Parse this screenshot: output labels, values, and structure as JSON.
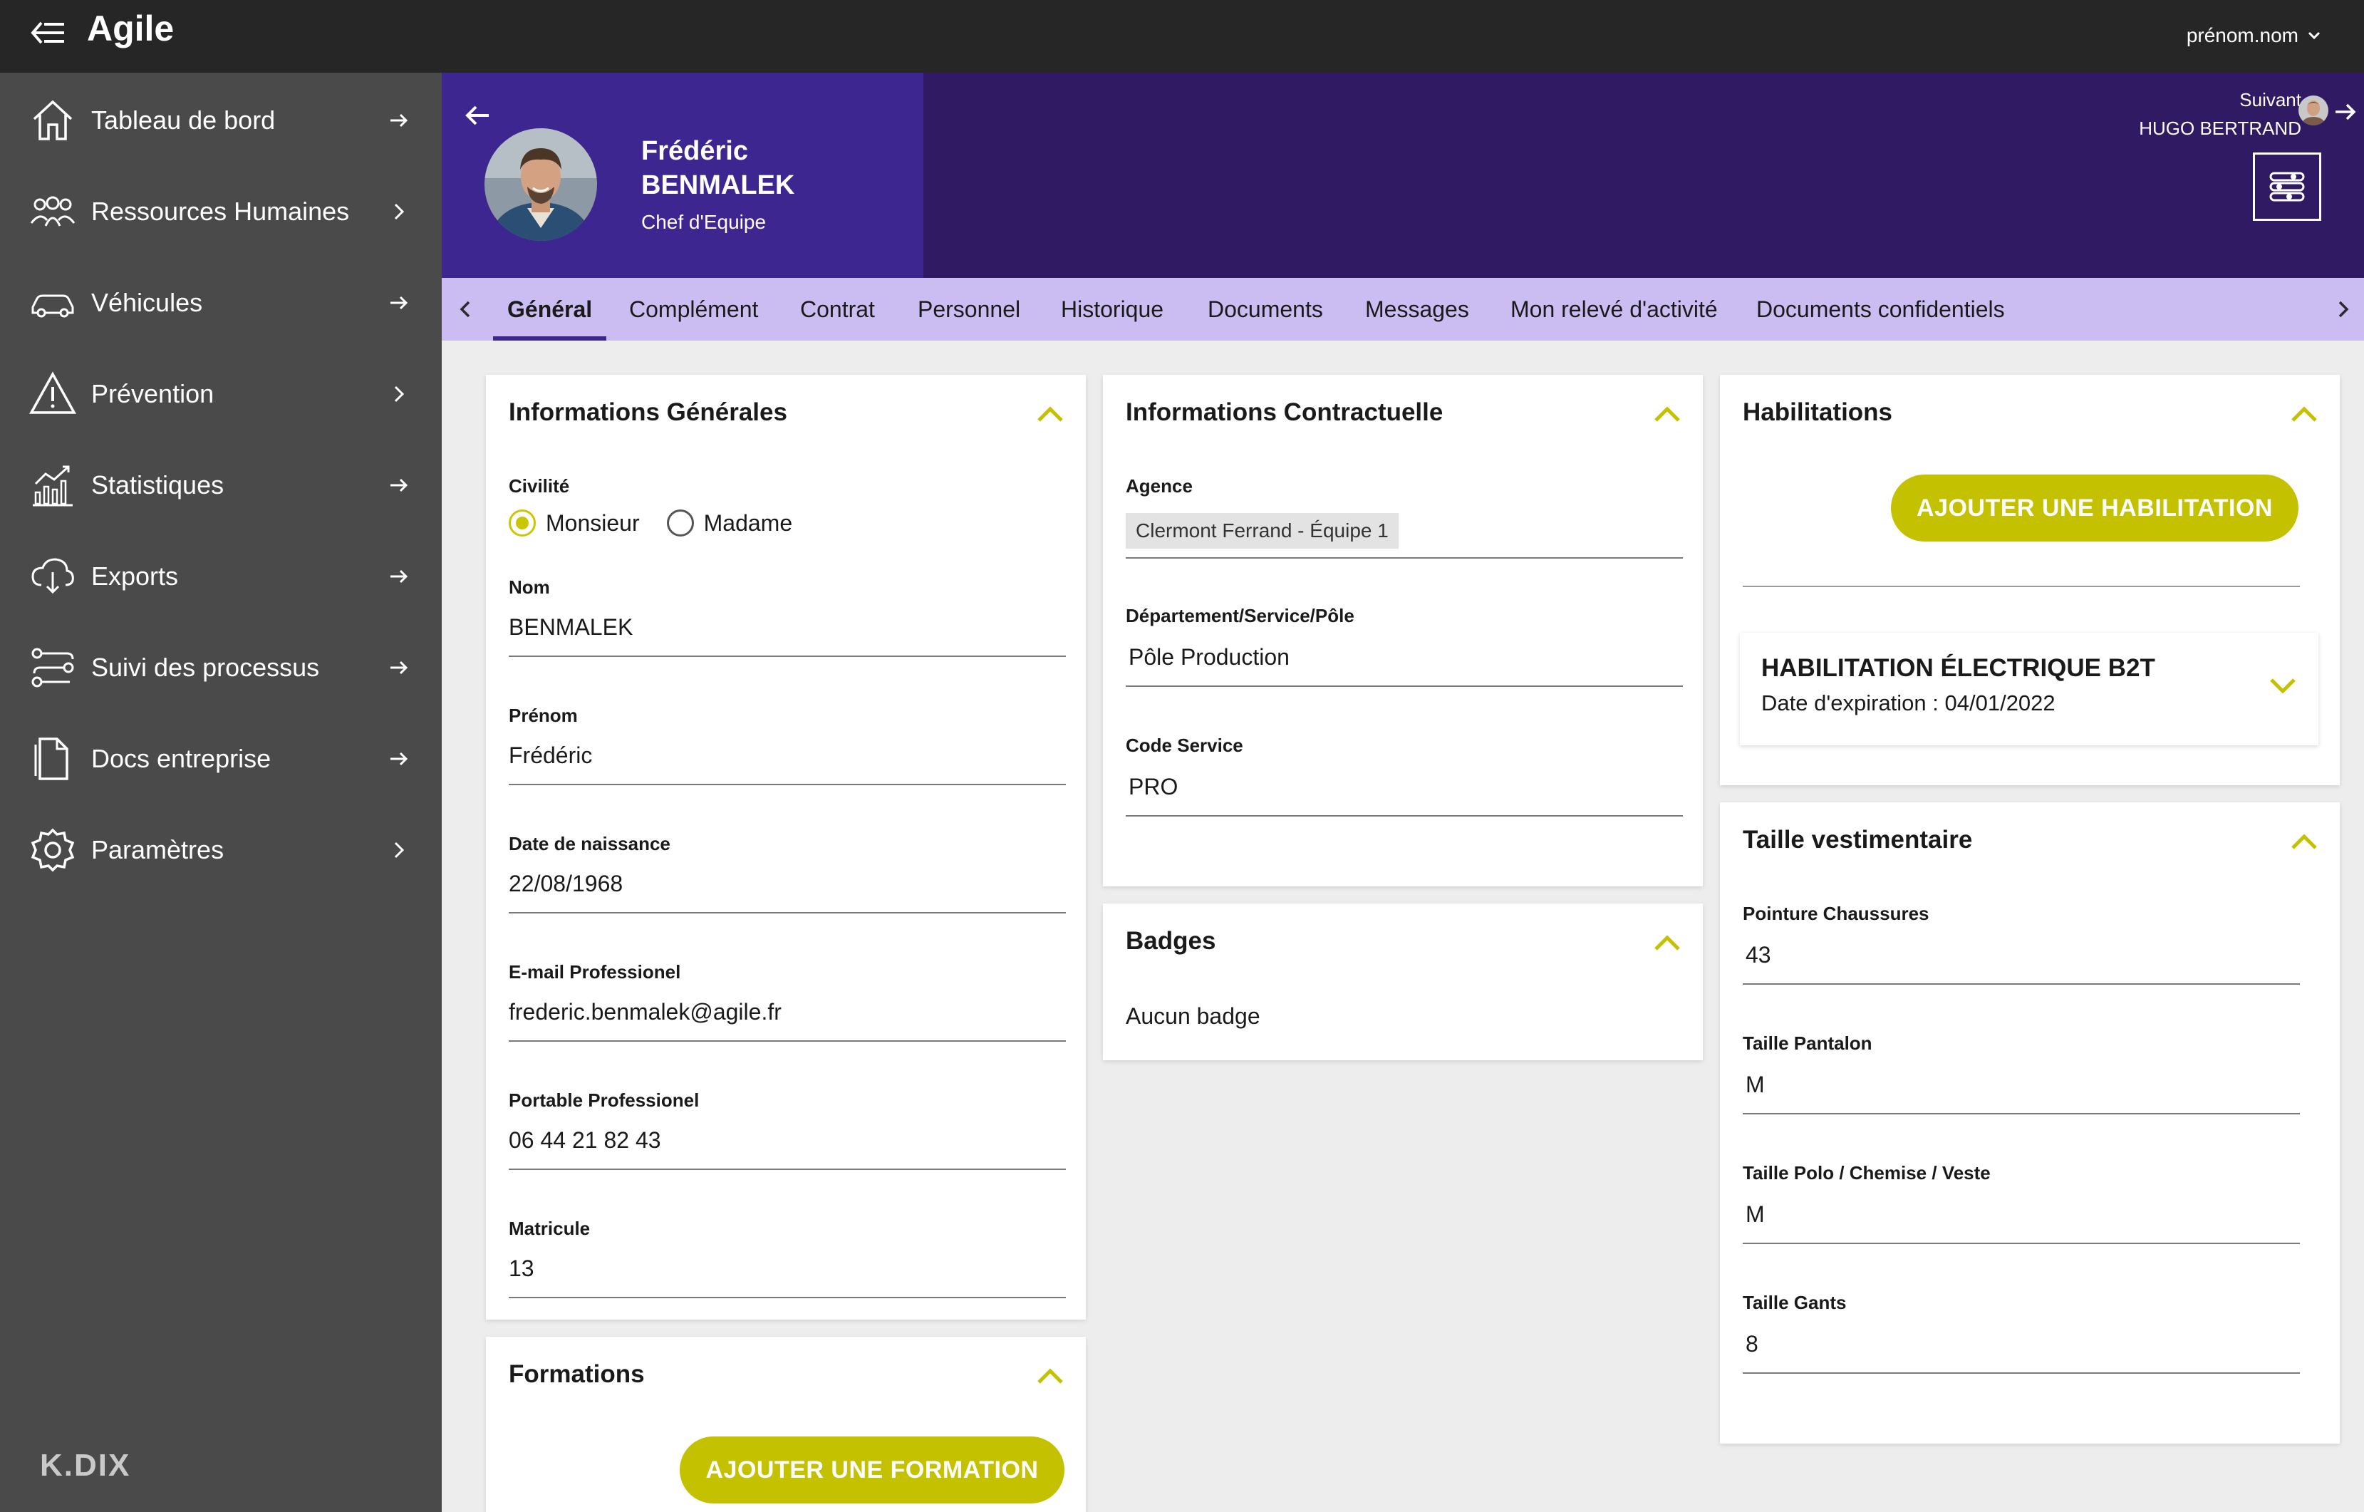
{
  "app": {
    "brand": "Agile",
    "user_menu": "prénom.nom"
  },
  "sidebar": {
    "items": [
      {
        "label": "Tableau de bord",
        "icon": "home-icon",
        "arrow": "arrow-right-icon"
      },
      {
        "label": "Ressources Humaines",
        "icon": "users-group-icon",
        "arrow": "chevron-right-icon"
      },
      {
        "label": "Véhicules",
        "icon": "car-icon",
        "arrow": "arrow-right-icon"
      },
      {
        "label": "Prévention",
        "icon": "warning-triangle-icon",
        "arrow": "chevron-right-icon"
      },
      {
        "label": "Statistiques",
        "icon": "bar-chart-icon",
        "arrow": "arrow-right-icon"
      },
      {
        "label": "Exports",
        "icon": "cloud-download-icon",
        "arrow": "arrow-right-icon"
      },
      {
        "label": "Suivi des processus",
        "icon": "process-icon",
        "arrow": "arrow-right-icon"
      },
      {
        "label": "Docs entreprise",
        "icon": "document-icon",
        "arrow": "arrow-right-icon"
      },
      {
        "label": "Paramètres",
        "icon": "gear-icon",
        "arrow": "chevron-right-icon"
      }
    ],
    "footer_logo": "K.DIX"
  },
  "employee": {
    "first_name": "Frédéric",
    "last_name": "BENMALEK",
    "role": "Chef d'Equipe"
  },
  "next": {
    "label": "Suivant",
    "name": "HUGO BERTRAND"
  },
  "tabs": [
    {
      "label": "Général",
      "active": true
    },
    {
      "label": "Complément"
    },
    {
      "label": "Contrat"
    },
    {
      "label": "Personnel"
    },
    {
      "label": "Historique"
    },
    {
      "label": "Documents"
    },
    {
      "label": "Messages"
    },
    {
      "label": "Mon relevé d'activité"
    },
    {
      "label": "Documents confidentiels"
    }
  ],
  "general": {
    "title": "Informations Générales",
    "civilite_label": "Civilité",
    "civilite_options": [
      "Monsieur",
      "Madame"
    ],
    "civilite_selected": "Monsieur",
    "fields": [
      {
        "label": "Nom",
        "value": "BENMALEK"
      },
      {
        "label": "Prénom",
        "value": "Frédéric"
      },
      {
        "label": "Date de naissance",
        "value": "22/08/1968"
      },
      {
        "label": "E-mail Professionel",
        "value": "frederic.benmalek@agile.fr"
      },
      {
        "label": "Portable Professionel",
        "value": "06 44 21 82 43"
      },
      {
        "label": "Matricule",
        "value": "13"
      }
    ]
  },
  "formations": {
    "title": "Formations",
    "add_button": "AJOUTER UNE FORMATION"
  },
  "contract": {
    "title": "Informations Contractuelle",
    "agence_label": "Agence",
    "agence_value": "Clermont Ferrand - Équipe 1",
    "fields": [
      {
        "label": "Département/Service/Pôle",
        "value": "Pôle Production"
      },
      {
        "label": "Code Service",
        "value": "PRO"
      }
    ]
  },
  "badges": {
    "title": "Badges",
    "empty_text": "Aucun badge"
  },
  "habilitations": {
    "title": "Habilitations",
    "add_button": "AJOUTER UNE HABILITATION",
    "items": [
      {
        "title": "HABILITATION ÉLECTRIQUE B2T",
        "expiry": "Date d'expiration : 04/01/2022"
      }
    ]
  },
  "sizes": {
    "title": "Taille vestimentaire",
    "fields": [
      {
        "label": "Pointure Chaussures",
        "value": "43"
      },
      {
        "label": "Taille Pantalon",
        "value": "M"
      },
      {
        "label": "Taille Polo / Chemise / Veste",
        "value": "M"
      },
      {
        "label": "Taille Gants",
        "value": "8"
      }
    ]
  },
  "colors": {
    "topbar": "#262626",
    "sidebar": "#4a4a4a",
    "banner": "#2f1a63",
    "banner_left": "#3e2690",
    "tabs": "#cbbcf2",
    "accent_yellow": "#c3c100"
  }
}
